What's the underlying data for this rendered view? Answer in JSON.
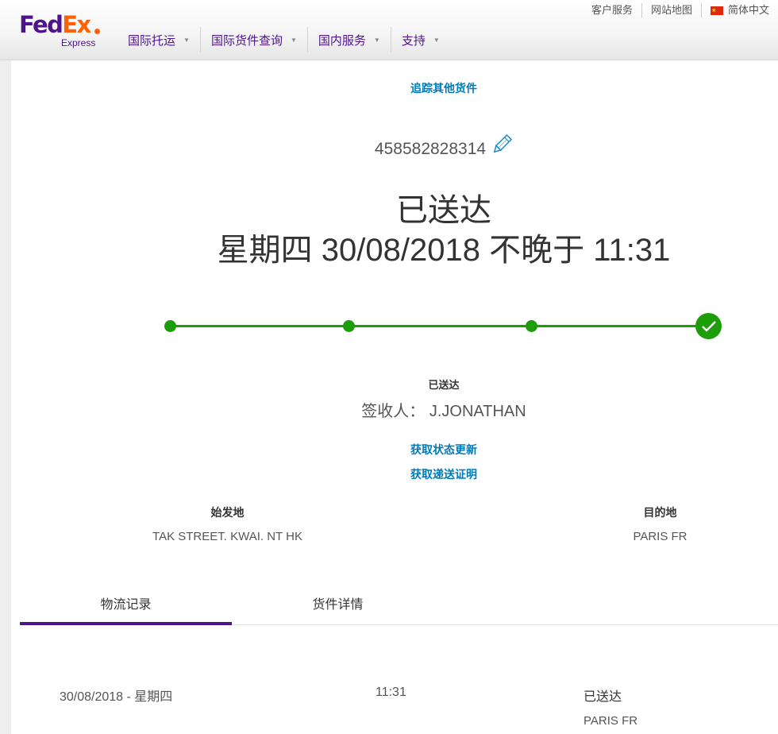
{
  "header": {
    "logo": {
      "fed": "Fed",
      "ex": "Ex",
      "sub": "Express"
    },
    "utility": [
      "客户服务",
      "网站地图",
      "简体中文"
    ],
    "nav": [
      "国际托运",
      "国际货件查询",
      "国内服务",
      "支持"
    ]
  },
  "tracking": {
    "track_other_link": "追踪其他货件",
    "tracking_number": "458582828314",
    "status_title": "已送达",
    "delivery_date": "星期四 30/08/2018 不晚于 11:31",
    "progress_complete_steps": 4,
    "progress_total_steps": 4,
    "status_small": "已送达",
    "signed_by": "签收人： J.JONATHAN",
    "status_update_link": "获取状态更新",
    "proof_link": "获取递送证明"
  },
  "origin": {
    "label": "始发地",
    "value": "TAK STREET. KWAI. NT HK"
  },
  "destination": {
    "label": "目的地",
    "value": "PARIS FR"
  },
  "tabs": [
    {
      "label": "物流记录",
      "active": true
    },
    {
      "label": "货件详情",
      "active": false
    }
  ],
  "history": [
    {
      "date": "30/08/2018 - 星期四",
      "time": "11:31",
      "status": "已送达",
      "location": "PARIS FR"
    }
  ],
  "colors": {
    "purple": "#4d148c",
    "orange": "#ff6200",
    "link": "#007ab7",
    "green": "#1d9d07"
  }
}
